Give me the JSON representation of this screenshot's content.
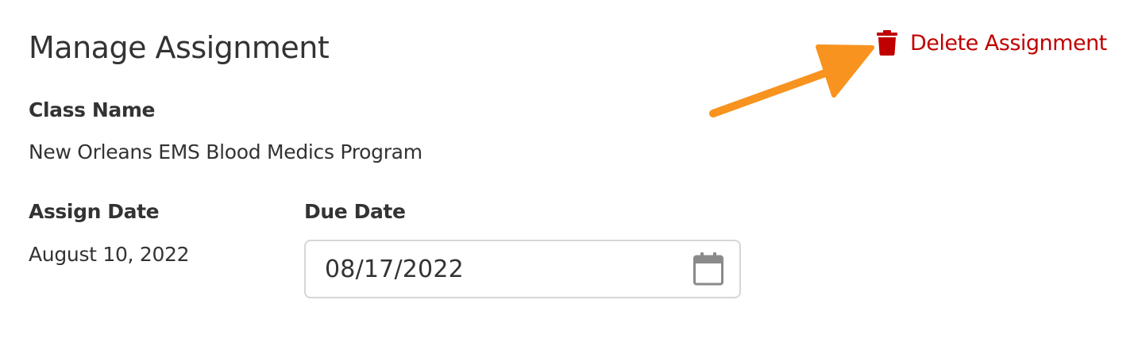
{
  "header": {
    "title": "Manage Assignment",
    "delete_label": "Delete Assignment",
    "delete_icon": "trash-icon"
  },
  "class": {
    "label": "Class Name",
    "value": "New Orleans EMS Blood Medics Program"
  },
  "assign_date": {
    "label": "Assign Date",
    "value": "August 10, 2022"
  },
  "due_date": {
    "label": "Due Date",
    "value": "08/17/2022",
    "icon": "calendar-icon"
  },
  "colors": {
    "danger": "#c00000",
    "annotation_arrow": "#f7931e",
    "text": "#333333",
    "field_border": "#d6d6d6"
  }
}
